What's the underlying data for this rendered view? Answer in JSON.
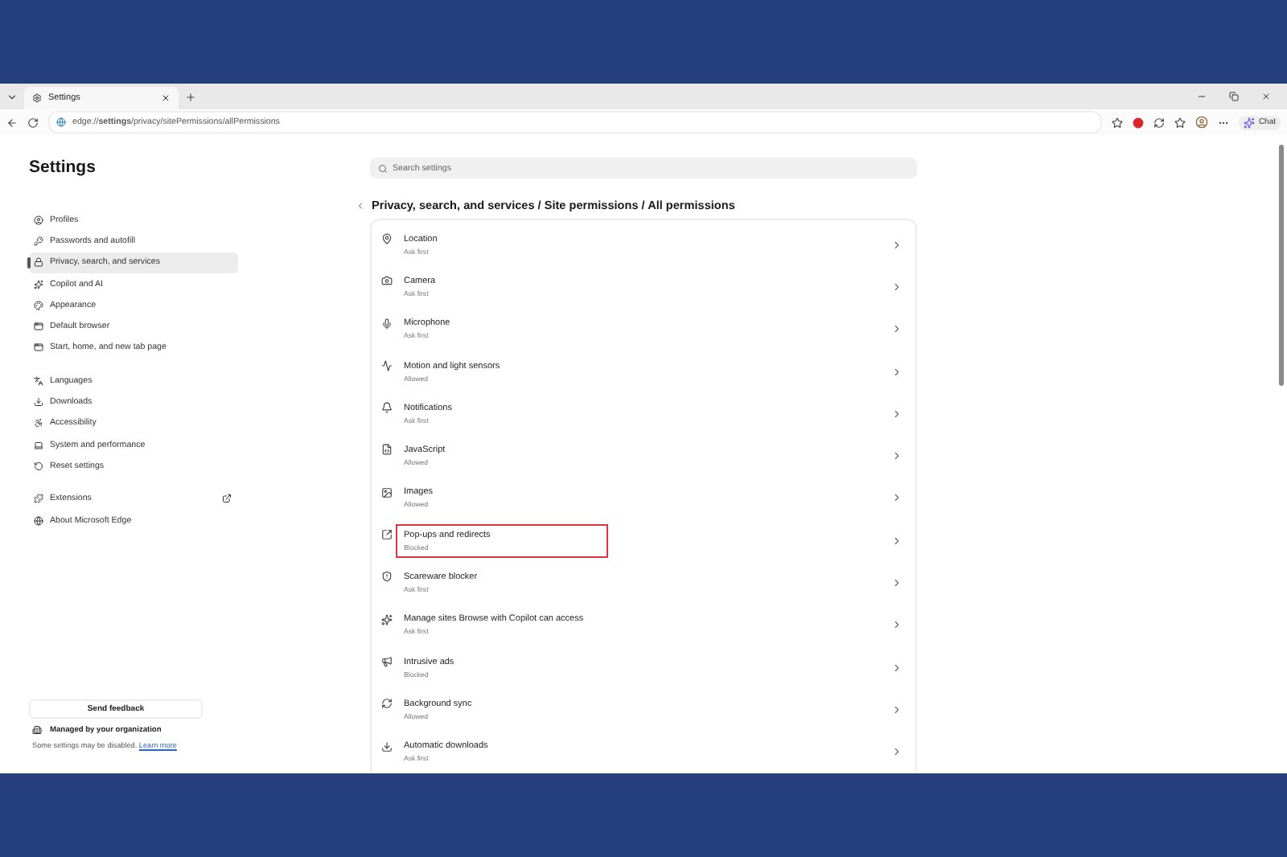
{
  "window": {
    "tab_title": "Settings",
    "url": "edge://**settings**/privacy/sitePermissions/allPermissions",
    "chat_label": "Chat"
  },
  "sidebar": {
    "title": "Settings",
    "groups": [
      {
        "items": [
          {
            "label": "Profiles",
            "selected": false,
            "external": false
          },
          {
            "label": "Passwords and autofill",
            "selected": false,
            "external": false
          },
          {
            "label": "Privacy, search, and services",
            "selected": true,
            "external": false
          },
          {
            "label": "Copilot and AI",
            "selected": false,
            "external": false
          },
          {
            "label": "Appearance",
            "selected": false,
            "external": false
          },
          {
            "label": "Default browser",
            "selected": false,
            "external": false
          },
          {
            "label": "Start, home, and new tab page",
            "selected": false,
            "external": false
          }
        ]
      },
      {
        "items": [
          {
            "label": "Languages",
            "selected": false,
            "external": false
          },
          {
            "label": "Downloads",
            "selected": false,
            "external": false
          },
          {
            "label": "Accessibility",
            "selected": false,
            "external": false
          },
          {
            "label": "System and performance",
            "selected": false,
            "external": false
          },
          {
            "label": "Reset settings",
            "selected": false,
            "external": false
          }
        ]
      },
      {
        "items": [
          {
            "label": "Extensions",
            "selected": false,
            "external": true
          },
          {
            "label": "About Microsoft Edge",
            "selected": false,
            "external": false
          }
        ]
      }
    ],
    "feedback_button": "Send feedback",
    "managed": "Managed by your organization",
    "note": "Some settings may be disabled.",
    "note_link": "Learn more"
  },
  "search": {
    "placeholder": "Search settings"
  },
  "breadcrumb": "Privacy, search, and services / Site permissions / All permissions",
  "permissions": [
    {
      "name": "Location",
      "status": "Ask first",
      "highlighted": false
    },
    {
      "name": "Camera",
      "status": "Ask first",
      "highlighted": false
    },
    {
      "name": "Microphone",
      "status": "Ask first",
      "highlighted": false
    },
    {
      "name": "Motion and light sensors",
      "status": "Allowed",
      "highlighted": false
    },
    {
      "name": "Notifications",
      "status": "Ask first",
      "highlighted": false
    },
    {
      "name": "JavaScript",
      "status": "Allowed",
      "highlighted": false
    },
    {
      "name": "Images",
      "status": "Allowed",
      "highlighted": false
    },
    {
      "name": "Pop-ups and redirects",
      "status": "Blocked",
      "highlighted": true
    },
    {
      "name": "Scareware blocker",
      "status": "Ask first",
      "highlighted": false
    },
    {
      "name": "Manage sites Browse with Copilot can access",
      "status": "Ask first",
      "highlighted": false
    },
    {
      "name": "Intrusive ads",
      "status": "Blocked",
      "highlighted": false
    },
    {
      "name": "Background sync",
      "status": "Allowed",
      "highlighted": false
    },
    {
      "name": "Automatic downloads",
      "status": "Ask first",
      "highlighted": false
    }
  ]
}
